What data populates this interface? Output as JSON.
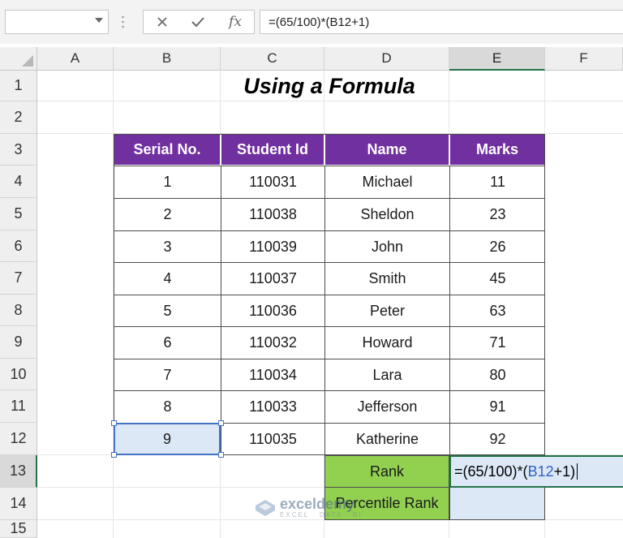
{
  "formula_bar": {
    "name_box": "",
    "cancel_icon": "close-icon",
    "enter_icon": "check-icon",
    "function_icon": "fx-icon",
    "fx_label": "fx",
    "formula": "=(65/100)*(B12+1)"
  },
  "columns": [
    "A",
    "B",
    "C",
    "D",
    "E",
    "F"
  ],
  "rows": [
    "1",
    "2",
    "3",
    "4",
    "5",
    "6",
    "7",
    "8",
    "9",
    "10",
    "11",
    "12",
    "13",
    "14",
    "15"
  ],
  "title": "Using a Formula",
  "table": {
    "headers": [
      "Serial No.",
      "Student Id",
      "Name",
      "Marks"
    ],
    "rows": [
      [
        "1",
        "110031",
        "Michael",
        "11"
      ],
      [
        "2",
        "110038",
        "Sheldon",
        "23"
      ],
      [
        "3",
        "110039",
        "John",
        "26"
      ],
      [
        "4",
        "110037",
        "Smith",
        "45"
      ],
      [
        "5",
        "110036",
        "Peter",
        "63"
      ],
      [
        "6",
        "110032",
        "Howard",
        "71"
      ],
      [
        "7",
        "110034",
        "Lara",
        "80"
      ],
      [
        "8",
        "110033",
        "Jefferson",
        "91"
      ],
      [
        "9",
        "110035",
        "Katherine",
        "92"
      ]
    ]
  },
  "rank": {
    "label": "Rank",
    "edit_prefix": "=(65/100)*(",
    "edit_ref": "B12",
    "edit_suffix": "+1)"
  },
  "percentile_rank": {
    "label": "Percentile Rank",
    "value": ""
  },
  "watermark": {
    "name": "exceldemy",
    "tagline": "EXCEL · DATA · BI"
  },
  "colors": {
    "header_fill": "#7030a0",
    "label_fill": "#92d050",
    "selection_fill": "#dde8f6",
    "selection_border": "#4472c4",
    "active_border": "#217346",
    "reference_text": "#2f5fc4"
  }
}
